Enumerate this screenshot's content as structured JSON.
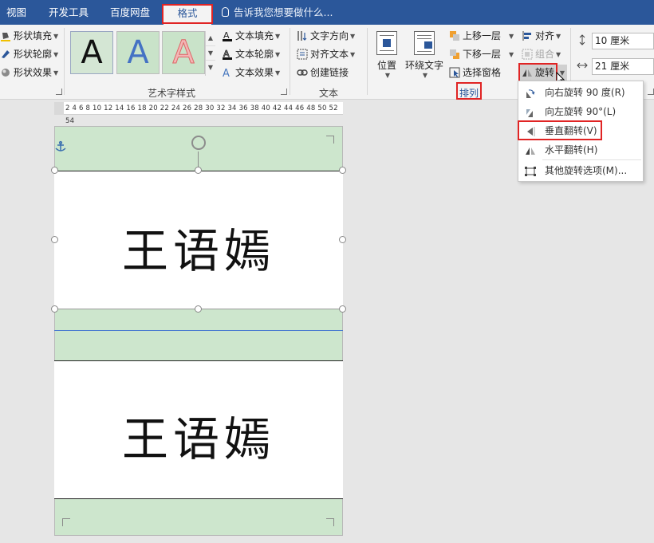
{
  "tabs": {
    "view": "视图",
    "developer": "开发工具",
    "baidu": "百度网盘",
    "format": "格式",
    "tell_me": "告诉我您想要做什么..."
  },
  "shape_styles": {
    "fill": "形状填充",
    "outline": "形状轮廓",
    "effects": "形状效果"
  },
  "wordart": {
    "sample_letter": "A",
    "text_fill": "文本填充",
    "text_outline": "文本轮廓",
    "text_effects": "文本效果",
    "group_label": "艺术字样式"
  },
  "text_group": {
    "direction": "文字方向",
    "align": "对齐文本",
    "link": "创建链接",
    "group_label": "文本"
  },
  "arrange": {
    "position": "位置",
    "wrap": "环绕文字",
    "bring_forward": "上移一层",
    "send_backward": "下移一层",
    "selection_pane": "选择窗格",
    "align": "对齐",
    "group": "组合",
    "rotate": "旋转",
    "group_label": "排列"
  },
  "size": {
    "height": "10 厘米",
    "width": "21 厘米"
  },
  "ruler": {
    "numbers": "2  4  6  8  10 12 14 16 18 20 22 24 26 28 30 32 34 36 38 40 42 44 46 48 50 52 54"
  },
  "document": {
    "name_top": "王语嫣",
    "name_bottom": "王语嫣"
  },
  "rotate_menu": {
    "items": [
      {
        "label": "向右旋转 90 度(R)"
      },
      {
        "label": "向左旋转 90°(L)"
      },
      {
        "label": "垂直翻转(V)"
      },
      {
        "label": "水平翻转(H)"
      },
      {
        "label": "其他旋转选项(M)..."
      }
    ]
  },
  "colors": {
    "title_bar": "#2b579a",
    "highlight": "#e02424",
    "page_green": "#cde6cd"
  }
}
